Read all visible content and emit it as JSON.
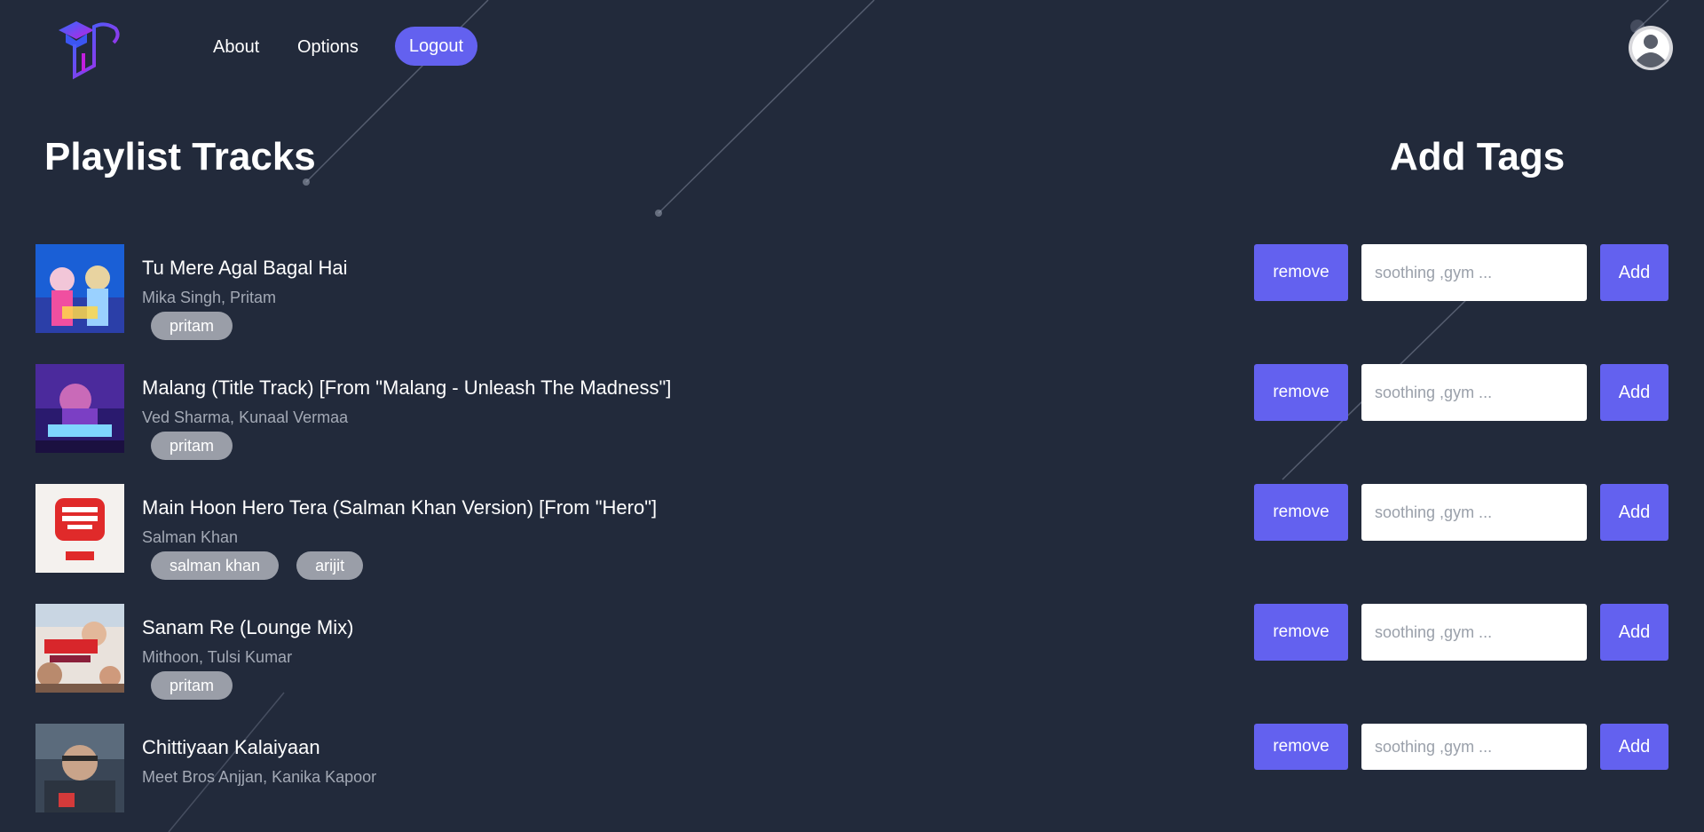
{
  "nav": {
    "about_label": "About",
    "options_label": "Options",
    "logout_label": "Logout"
  },
  "sections": {
    "tracks_title": "Playlist Tracks",
    "tags_title": "Add Tags"
  },
  "tag_controls": {
    "remove_label": "remove",
    "input_placeholder": "soothing ,gym ...",
    "add_label": "Add"
  },
  "tracks": [
    {
      "title": "Tu Mere Agal Bagal Hai",
      "artists": "Mika Singh, Pritam",
      "tags": [
        "pritam"
      ]
    },
    {
      "title": "Malang (Title Track) [From \"Malang - Unleash The Madness\"]",
      "artists": "Ved Sharma, Kunaal Vermaa",
      "tags": [
        "pritam"
      ]
    },
    {
      "title": "Main Hoon Hero Tera (Salman Khan Version) [From \"Hero\"]",
      "artists": "Salman Khan",
      "tags": [
        "salman khan",
        "arijit"
      ]
    },
    {
      "title": "Sanam Re (Lounge Mix)",
      "artists": "Mithoon, Tulsi Kumar",
      "tags": [
        "pritam"
      ]
    },
    {
      "title": "Chittiyaan Kalaiyaan",
      "artists": "Meet Bros Anjjan, Kanika Kapoor",
      "tags": []
    }
  ],
  "colors": {
    "background": "#222a3b",
    "accent": "#6361ef",
    "tag_chip": "#9a9ea8",
    "muted_text": "#a3a9b5"
  }
}
